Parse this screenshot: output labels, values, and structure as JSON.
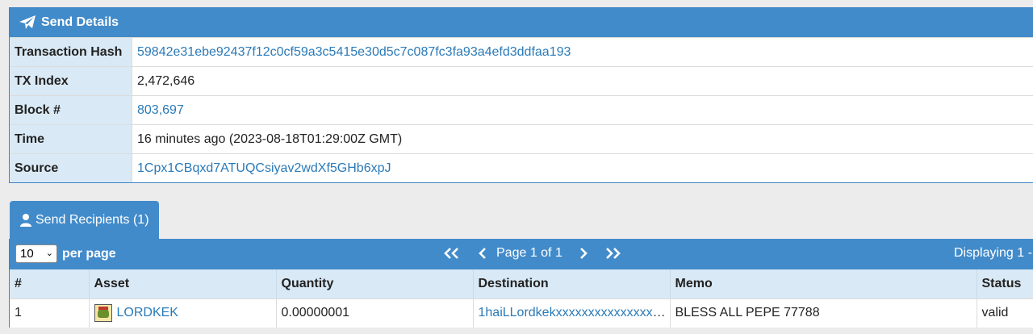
{
  "details": {
    "title": "Send Details",
    "rows": [
      {
        "key": "Transaction Hash",
        "value": "59842e31ebe92437f12c0cf59a3c5415e30d5c7c087fc3fa93a4efd3ddfaa193"
      },
      {
        "key": "TX Index",
        "value": "2,472,646"
      },
      {
        "key": "Block #",
        "value": "803,697"
      },
      {
        "key": "Time",
        "value": "16 minutes ago (2023-08-18T01:29:00Z GMT)"
      },
      {
        "key": "Source",
        "value": "1Cpx1CBqxd7ATUQCsiyav2wdXf5GHb6xpJ"
      }
    ]
  },
  "recipients": {
    "tab_label": "Send Recipients (1)",
    "per_page_value": "10",
    "per_page_label": "per page",
    "page_label": "Page 1 of 1",
    "displaying": "Displaying 1 -",
    "columns": [
      "#",
      "Asset",
      "Quantity",
      "Destination",
      "Memo",
      "Status"
    ],
    "rows": [
      {
        "index": "1",
        "asset": "LORDKEK",
        "quantity": "0.00000001",
        "destination": "1haiLLordkekxxxxxxxxxxxxxxxxxx",
        "memo": "BLESS ALL PEPE 77788",
        "status": "valid"
      }
    ]
  },
  "colors": {
    "header_blue": "#428bca",
    "key_cell_bg": "#d9e9f5",
    "link": "#2a7ab8"
  },
  "icons": {
    "details": "paper-plane-icon",
    "recipients_tab": "user-icon",
    "pager_first": "double-chevron-left-icon",
    "pager_prev": "chevron-left-icon",
    "pager_next": "chevron-right-icon",
    "pager_last": "double-chevron-right-icon",
    "asset": "asset-thumbnail-icon"
  }
}
